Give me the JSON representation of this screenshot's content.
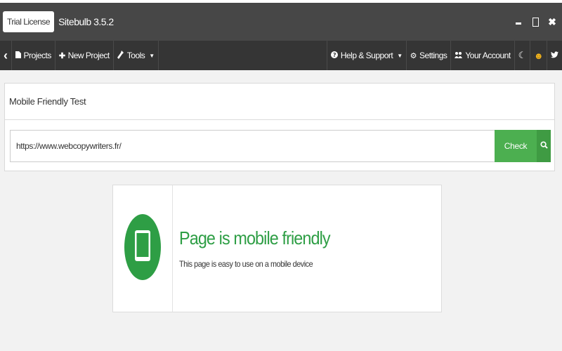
{
  "titlebar": {
    "license_badge": "Trial License",
    "app_title": "Sitebulb 3.5.2",
    "close_symbol": "✖"
  },
  "toolbar": {
    "back_symbol": "‹",
    "projects": "Projects",
    "new_project": "New Project",
    "tools": "Tools",
    "help_support": "Help & Support",
    "settings": "Settings",
    "your_account": "Your Account"
  },
  "panel": {
    "title": "Mobile Friendly Test",
    "url_value": "https://www.webcopywriters.fr/",
    "check_label": "Check"
  },
  "result": {
    "title": "Page is mobile friendly",
    "description": "This page is easy to use on a mobile device"
  },
  "colors": {
    "accent_green": "#4caf50",
    "result_green": "#2e9e45",
    "titlebar_bg": "#474747",
    "toolbar_bg": "#353535"
  }
}
